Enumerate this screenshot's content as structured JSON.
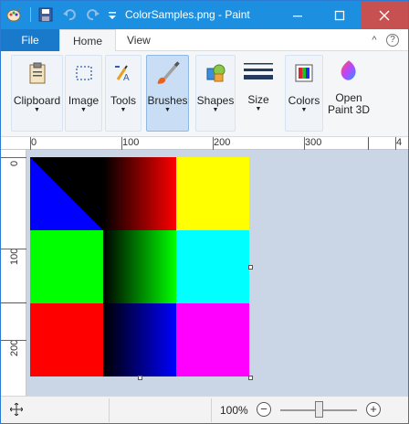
{
  "window": {
    "title": "ColorSamples.png - Paint",
    "controls": {
      "minimize": "—",
      "maximize": "☐",
      "close": "✕"
    }
  },
  "quick_access": {
    "icons": [
      "paint-app-icon",
      "save-icon",
      "undo-icon",
      "redo-icon",
      "customize-qa-icon"
    ]
  },
  "tabs": [
    {
      "label": "File"
    },
    {
      "label": "Home",
      "active": true
    },
    {
      "label": "View"
    }
  ],
  "ribbon_controls": {
    "collapse": "^",
    "help": "?"
  },
  "ribbon": {
    "groups": [
      {
        "label": "Clipboard",
        "icon": "clipboard-icon",
        "dropdown": "▼"
      },
      {
        "label": "Image",
        "icon": "select-icon",
        "dropdown": "▼"
      },
      {
        "label": "Tools",
        "icon": "tools-icon",
        "dropdown": "▼"
      },
      {
        "label": "Brushes",
        "icon": "brush-icon",
        "dropdown": "▼",
        "active": true
      },
      {
        "label": "Shapes",
        "icon": "shapes-icon",
        "dropdown": "▼"
      },
      {
        "label": "Size",
        "icon": "size-lines-icon",
        "dropdown": "▼"
      },
      {
        "label": "Colors",
        "icon": "colors-icon",
        "dropdown": "▼"
      },
      {
        "label": "Open Paint 3D",
        "icon": "paint3d-icon"
      }
    ]
  },
  "rulers": {
    "top_labels": [
      "0",
      "100",
      "200",
      "300",
      "4"
    ],
    "left_labels": [
      "0",
      "100",
      "200"
    ]
  },
  "canvas": {
    "colors": {
      "blue": "#0000ff",
      "black": "#000000",
      "red": "#ff0000",
      "yellow": "#ffff00",
      "green": "#00ff00",
      "cyan": "#00ffff",
      "magenta": "#ff00ff"
    }
  },
  "statusbar": {
    "zoom_level": "100%",
    "zoom_out": "−",
    "zoom_in": "+",
    "zoom_slider_fraction": 0.5
  }
}
